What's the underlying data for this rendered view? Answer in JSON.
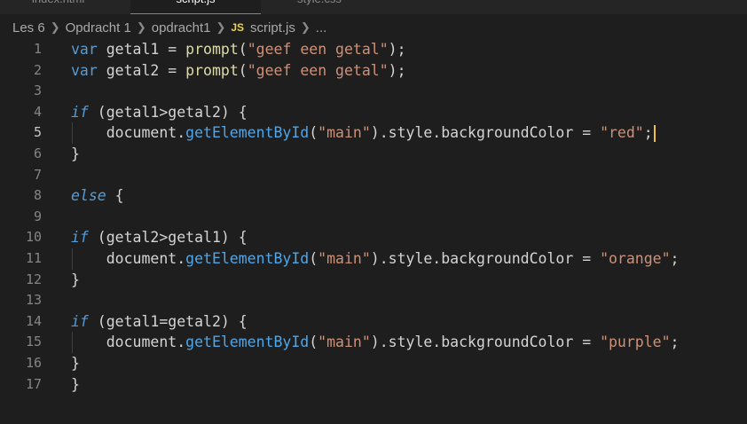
{
  "tabs": [
    {
      "label": "index.html",
      "active": false
    },
    {
      "label": "script.js",
      "active": true
    },
    {
      "label": "style.css",
      "active": false
    }
  ],
  "breadcrumb": {
    "items": [
      "Les 6",
      "Opdracht 1",
      "opdracht1"
    ],
    "file_badge": "JS",
    "file": "script.js",
    "more": "..."
  },
  "editor": {
    "current_line": 5,
    "lines": [
      {
        "n": "1",
        "segs": [
          [
            "kw",
            "var"
          ],
          [
            "var",
            " getal1 "
          ],
          [
            "op",
            "= "
          ],
          [
            "fn",
            "prompt"
          ],
          [
            "paren",
            "("
          ],
          [
            "str",
            "\"geef een getal\""
          ],
          [
            "paren",
            ");"
          ]
        ]
      },
      {
        "n": "2",
        "segs": [
          [
            "kw",
            "var"
          ],
          [
            "var",
            " getal2 "
          ],
          [
            "op",
            "= "
          ],
          [
            "fn",
            "prompt"
          ],
          [
            "paren",
            "("
          ],
          [
            "str",
            "\"geef een getal\""
          ],
          [
            "paren",
            ");"
          ]
        ]
      },
      {
        "n": "3",
        "segs": []
      },
      {
        "n": "4",
        "segs": [
          [
            "ctl",
            "if"
          ],
          [
            "paren",
            " (getal1"
          ],
          [
            "op",
            ">"
          ],
          [
            "var",
            "getal2) "
          ],
          [
            "brace",
            "{"
          ]
        ]
      },
      {
        "n": "5",
        "guide": true,
        "cursor": true,
        "segs": [
          [
            "var",
            "    document."
          ],
          [
            "method",
            "getElementById"
          ],
          [
            "paren",
            "("
          ],
          [
            "str",
            "\"main\""
          ],
          [
            "paren",
            ")"
          ],
          [
            "prop",
            ".style.backgroundColor "
          ],
          [
            "op",
            "= "
          ],
          [
            "str",
            "\"red\""
          ],
          [
            "paren",
            ";"
          ]
        ]
      },
      {
        "n": "6",
        "segs": [
          [
            "brace",
            "}"
          ]
        ]
      },
      {
        "n": "7",
        "segs": []
      },
      {
        "n": "8",
        "segs": [
          [
            "ctl",
            "else"
          ],
          [
            "brace",
            " {"
          ]
        ]
      },
      {
        "n": "9",
        "segs": []
      },
      {
        "n": "10",
        "segs": [
          [
            "ctl",
            "if"
          ],
          [
            "paren",
            " (getal2"
          ],
          [
            "op",
            ">"
          ],
          [
            "var",
            "getal1) "
          ],
          [
            "brace",
            "{"
          ]
        ]
      },
      {
        "n": "11",
        "guide": true,
        "segs": [
          [
            "var",
            "    document."
          ],
          [
            "method",
            "getElementById"
          ],
          [
            "paren",
            "("
          ],
          [
            "str",
            "\"main\""
          ],
          [
            "paren",
            ")"
          ],
          [
            "prop",
            ".style.backgroundColor "
          ],
          [
            "op",
            "= "
          ],
          [
            "str",
            "\"orange\""
          ],
          [
            "paren",
            ";"
          ]
        ]
      },
      {
        "n": "12",
        "segs": [
          [
            "brace",
            "}"
          ]
        ]
      },
      {
        "n": "13",
        "segs": []
      },
      {
        "n": "14",
        "segs": [
          [
            "ctl",
            "if"
          ],
          [
            "paren",
            " (getal1"
          ],
          [
            "op",
            "="
          ],
          [
            "var",
            "getal2) "
          ],
          [
            "brace",
            "{"
          ]
        ]
      },
      {
        "n": "15",
        "guide": true,
        "segs": [
          [
            "var",
            "    document."
          ],
          [
            "method",
            "getElementById"
          ],
          [
            "paren",
            "("
          ],
          [
            "str",
            "\"main\""
          ],
          [
            "paren",
            ")"
          ],
          [
            "prop",
            ".style.backgroundColor "
          ],
          [
            "op",
            "= "
          ],
          [
            "str",
            "\"purple\""
          ],
          [
            "paren",
            ";"
          ]
        ]
      },
      {
        "n": "16",
        "segs": [
          [
            "brace",
            "}"
          ]
        ]
      },
      {
        "n": "17",
        "segs": [
          [
            "brace",
            "}"
          ]
        ]
      }
    ]
  }
}
